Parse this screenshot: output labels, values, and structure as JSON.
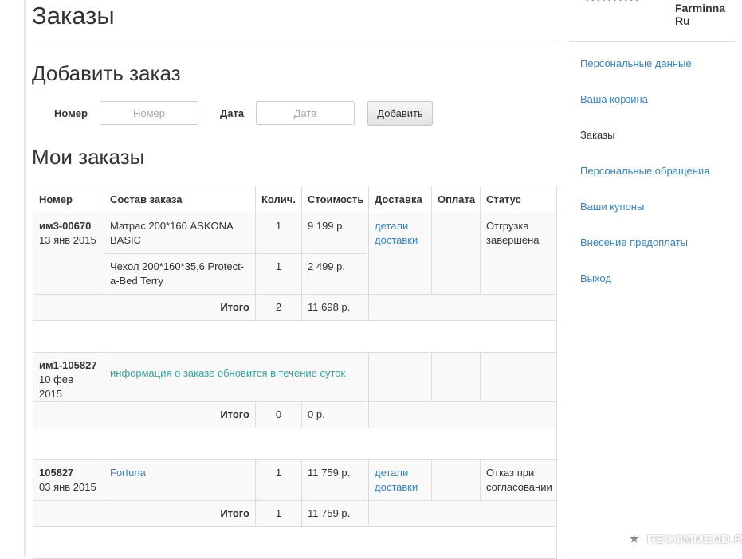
{
  "page": {
    "title": "Заказы",
    "add_order_heading": "Добавить заказ",
    "my_orders_heading": "Мои заказы"
  },
  "form": {
    "number_label": "Номер",
    "number_placeholder": "Номер",
    "date_label": "Дата",
    "date_placeholder": "Дата",
    "add_button": "Добавить"
  },
  "table": {
    "headers": [
      "Номер",
      "Состав заказа",
      "Колич.",
      "Стоимость",
      "Доставка",
      "Оплата",
      "Статус"
    ],
    "total_label": "Итого",
    "orders": [
      {
        "number": "им3-00670",
        "date": "13 янв 2015",
        "items": [
          {
            "name": "Матрас 200*160 ASKONA BASIC",
            "qty": "1",
            "cost": "9 199 р."
          },
          {
            "name": "Чехол 200*160*35,6 Protect-a-Bed Terry",
            "qty": "1",
            "cost": "2 499 р."
          }
        ],
        "delivery": "детали доставки",
        "payment": "",
        "status": "Отгрузка завершена",
        "total_qty": "2",
        "total_cost": "11 698 р."
      },
      {
        "number": "им1-105827",
        "date": "10 фев 2015",
        "info": "информация о заказе обновится в течение суток",
        "total_qty": "0",
        "total_cost": "0 р."
      },
      {
        "number": "105827",
        "date": "03 янв 2015",
        "items": [
          {
            "name": "Fortuna",
            "qty": "1",
            "cost": "11 759 р."
          }
        ],
        "delivery": "детали доставки",
        "payment": "",
        "status": "Отказ при согласовании",
        "total_qty": "1",
        "total_cost": "11 759 р."
      }
    ]
  },
  "sidebar": {
    "user_name": "Farminna Ru",
    "user_dots": "• • • • • • • • • •",
    "items": [
      {
        "label": "Персональные данные",
        "active": false
      },
      {
        "label": "Ваша корзина",
        "active": false
      },
      {
        "label": "Заказы",
        "active": true
      },
      {
        "label": "Персональные обращения",
        "active": false
      },
      {
        "label": "Ваши купоны",
        "active": false
      },
      {
        "label": "Внесение предоплаты",
        "active": false
      },
      {
        "label": "Выход",
        "active": false
      }
    ]
  },
  "watermark": {
    "text": "RECOMMEND.RU",
    "icon": "★"
  },
  "colors": {
    "link": "#3a83b8",
    "info": "#3aa0a0",
    "row_shade": "#f9f9f9",
    "border": "#dddddd"
  }
}
